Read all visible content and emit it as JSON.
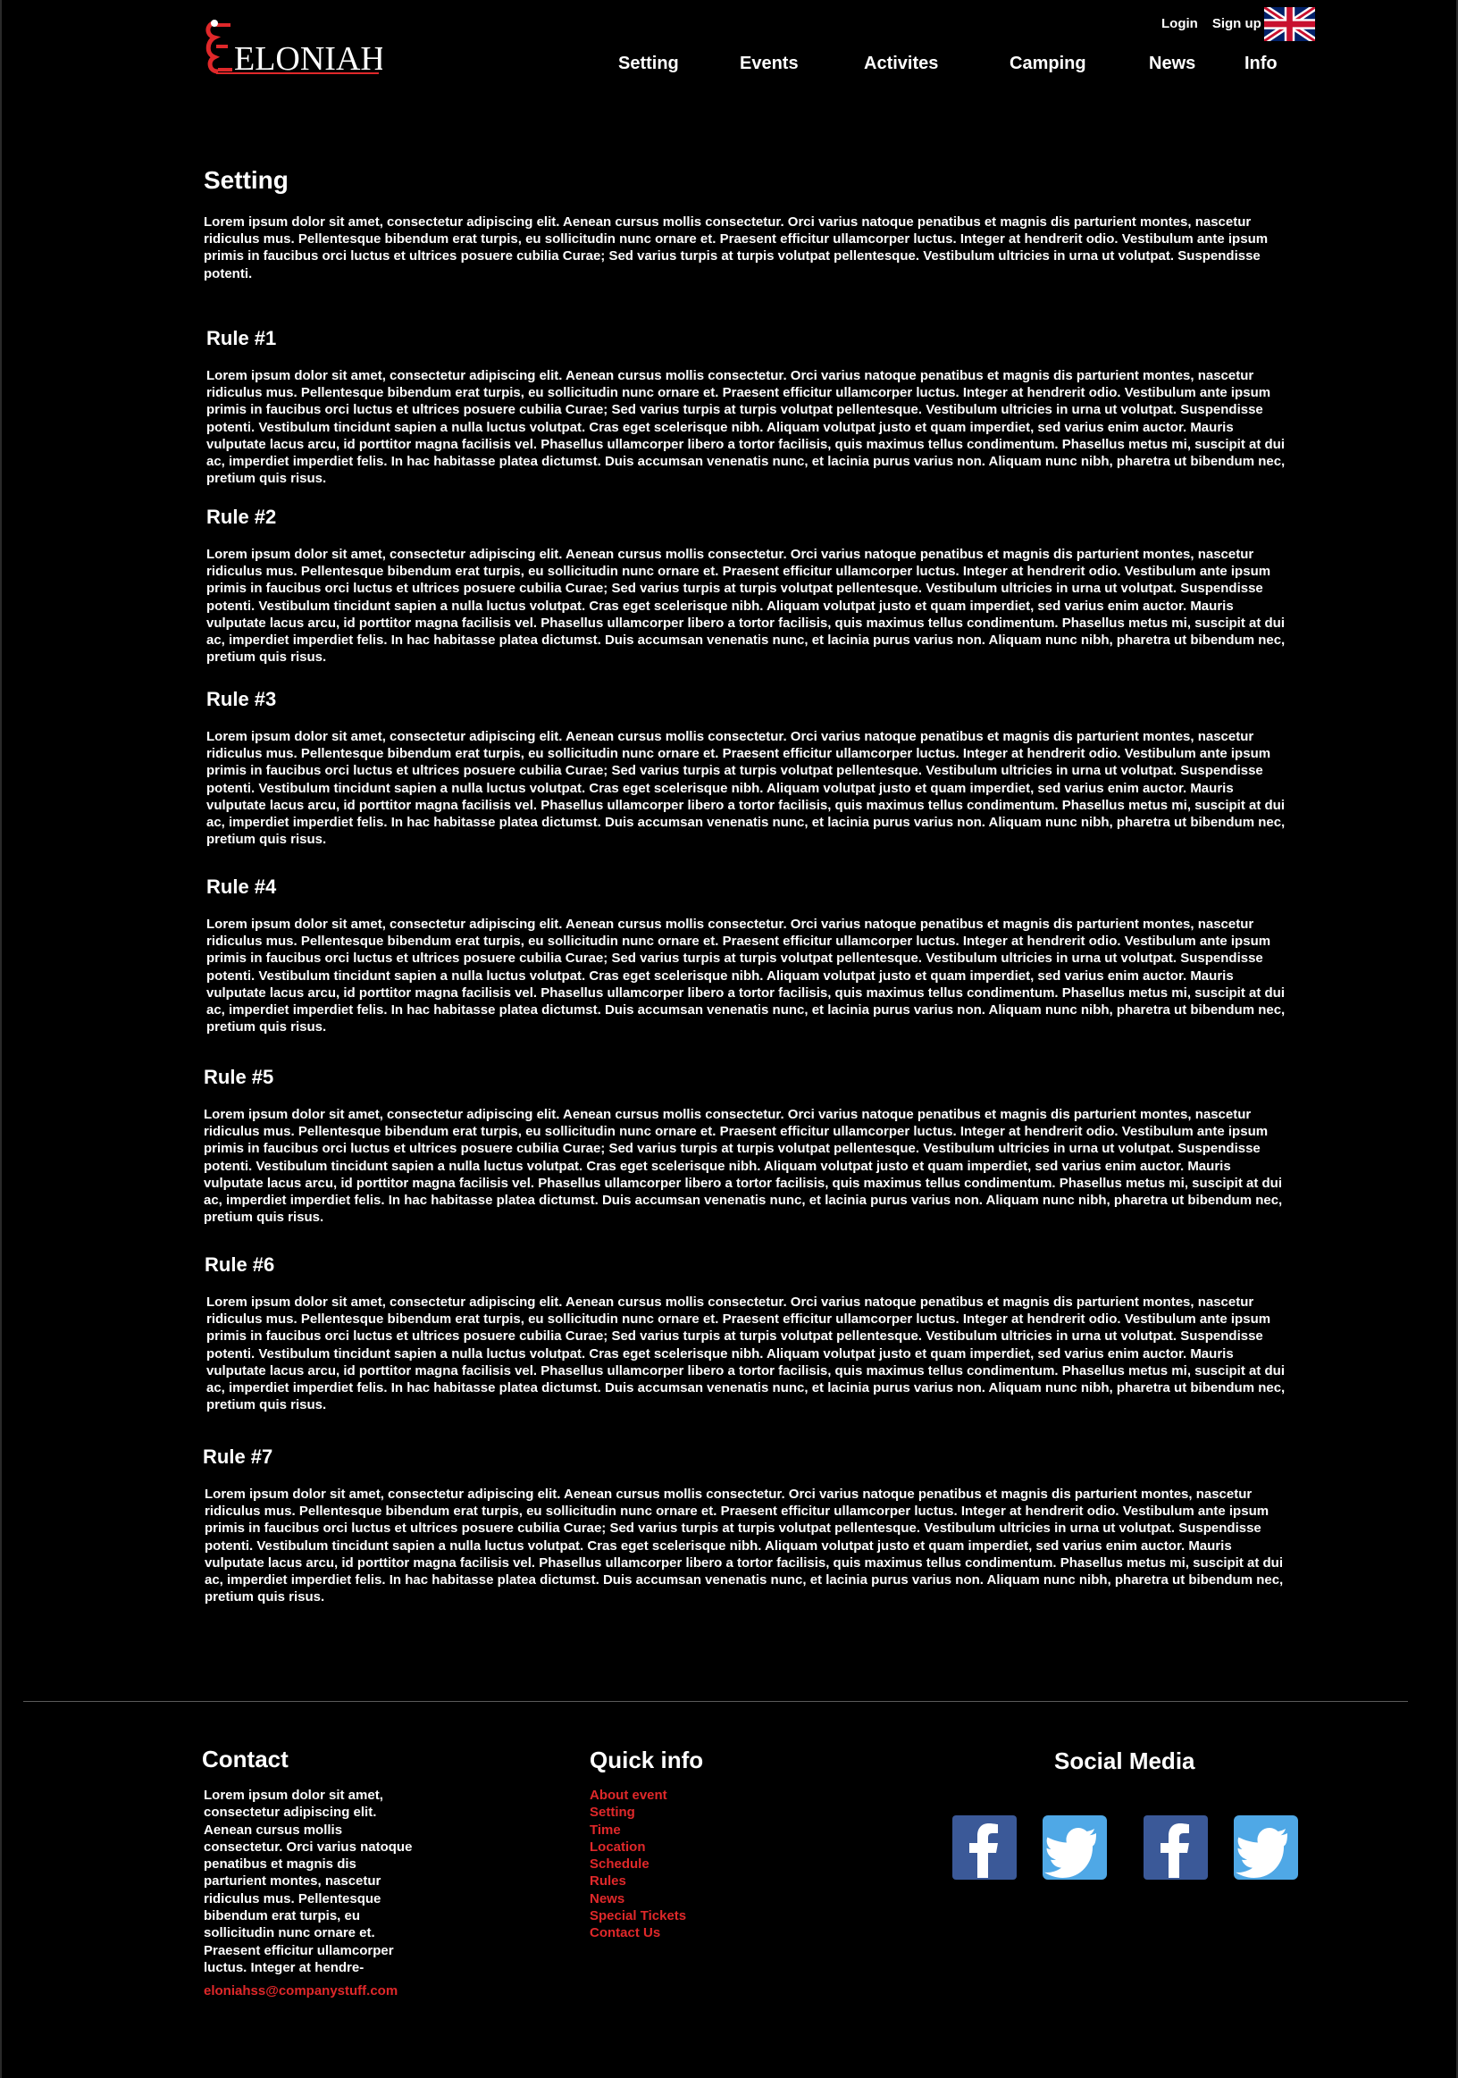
{
  "header": {
    "logo_text": "ELONIAH",
    "login_label": "Login",
    "signup_label": "Sign up",
    "language_icon": "uk-flag-icon"
  },
  "nav": {
    "items": [
      {
        "label": "Setting"
      },
      {
        "label": "Events"
      },
      {
        "label": "Activites"
      },
      {
        "label": "Camping"
      },
      {
        "label": "News"
      },
      {
        "label": "Info"
      }
    ]
  },
  "main": {
    "title": "Setting",
    "intro": "Lorem ipsum dolor sit amet, consectetur adipiscing elit. Aenean cursus mollis consectetur. Orci varius natoque penatibus et magnis dis parturient montes, nascetur ridiculus mus. Pellentesque bibendum erat turpis, eu sollicitudin nunc ornare et. Praesent efficitur ullamcorper luctus. Integer at hendrerit odio. Vestibulum ante ipsum primis in faucibus orci luctus et ultrices posuere cubilia Curae; Sed varius turpis at turpis volutpat pellentesque. Vestibulum ultricies in urna ut volutpat. Suspendisse potenti.",
    "rules": [
      {
        "title": "Rule #1",
        "text": "Lorem ipsum dolor sit amet, consectetur adipiscing elit. Aenean cursus mollis consectetur. Orci varius natoque penatibus et magnis dis parturient montes, nascetur ridiculus mus. Pellentesque bibendum erat turpis, eu sollicitudin nunc ornare et. Praesent efficitur ullamcorper luctus. Integer at hendrerit odio. Vestibulum ante ipsum primis in faucibus orci luctus et ultrices posuere cubilia Curae; Sed varius turpis at turpis volutpat pellentesque. Vestibulum ultricies in urna ut volutpat. Suspendisse potenti. Vestibulum tincidunt sapien a nulla luctus volutpat. Cras eget scelerisque nibh. Aliquam volutpat justo et quam imperdiet, sed varius enim auctor. Mauris vulputate lacus arcu, id porttitor magna facilisis vel. Phasellus ullamcorper libero a tortor facilisis, quis maximus tellus condimentum. Phasellus metus mi, suscipit at dui ac, imperdiet imperdiet felis. In hac habitasse platea dictumst. Duis accumsan venenatis nunc, et lacinia purus varius non. Aliquam nunc nibh, pharetra ut bibendum nec, pretium quis risus."
      },
      {
        "title": "Rule #2",
        "text": "Lorem ipsum dolor sit amet, consectetur adipiscing elit. Aenean cursus mollis consectetur. Orci varius natoque penatibus et magnis dis parturient montes, nascetur ridiculus mus. Pellentesque bibendum erat turpis, eu sollicitudin nunc ornare et. Praesent efficitur ullamcorper luctus. Integer at hendrerit odio. Vestibulum ante ipsum primis in faucibus orci luctus et ultrices posuere cubilia Curae; Sed varius turpis at turpis volutpat pellentesque. Vestibulum ultricies in urna ut volutpat. Suspendisse potenti. Vestibulum tincidunt sapien a nulla luctus volutpat. Cras eget scelerisque nibh. Aliquam volutpat justo et quam imperdiet, sed varius enim auctor. Mauris vulputate lacus arcu, id porttitor magna facilisis vel. Phasellus ullamcorper libero a tortor facilisis, quis maximus tellus condimentum. Phasellus metus mi, suscipit at dui ac, imperdiet imperdiet felis. In hac habitasse platea dictumst. Duis accumsan venenatis nunc, et lacinia purus varius non. Aliquam nunc nibh, pharetra ut bibendum nec, pretium quis risus."
      },
      {
        "title": "Rule #3",
        "text": "Lorem ipsum dolor sit amet, consectetur adipiscing elit. Aenean cursus mollis consectetur. Orci varius natoque penatibus et magnis dis parturient montes, nascetur ridiculus mus. Pellentesque bibendum erat turpis, eu sollicitudin nunc ornare et. Praesent efficitur ullamcorper luctus. Integer at hendrerit odio. Vestibulum ante ipsum primis in faucibus orci luctus et ultrices posuere cubilia Curae; Sed varius turpis at turpis volutpat pellentesque. Vestibulum ultricies in urna ut volutpat. Suspendisse potenti. Vestibulum tincidunt sapien a nulla luctus volutpat. Cras eget scelerisque nibh. Aliquam volutpat justo et quam imperdiet, sed varius enim auctor. Mauris vulputate lacus arcu, id porttitor magna facilisis vel. Phasellus ullamcorper libero a tortor facilisis, quis maximus tellus condimentum. Phasellus metus mi, suscipit at dui ac, imperdiet imperdiet felis. In hac habitasse platea dictumst. Duis accumsan venenatis nunc, et lacinia purus varius non. Aliquam nunc nibh, pharetra ut bibendum nec, pretium quis risus."
      },
      {
        "title": "Rule #4",
        "text": "Lorem ipsum dolor sit amet, consectetur adipiscing elit. Aenean cursus mollis consectetur. Orci varius natoque penatibus et magnis dis parturient montes, nascetur ridiculus mus. Pellentesque bibendum erat turpis, eu sollicitudin nunc ornare et. Praesent efficitur ullamcorper luctus. Integer at hendrerit odio. Vestibulum ante ipsum primis in faucibus orci luctus et ultrices posuere cubilia Curae; Sed varius turpis at turpis volutpat pellentesque. Vestibulum ultricies in urna ut volutpat. Suspendisse potenti. Vestibulum tincidunt sapien a nulla luctus volutpat. Cras eget scelerisque nibh. Aliquam volutpat justo et quam imperdiet, sed varius enim auctor. Mauris vulputate lacus arcu, id porttitor magna facilisis vel. Phasellus ullamcorper libero a tortor facilisis, quis maximus tellus condimentum. Phasellus metus mi, suscipit at dui ac, imperdiet imperdiet felis. In hac habitasse platea dictumst. Duis accumsan venenatis nunc, et lacinia purus varius non. Aliquam nunc nibh, pharetra ut bibendum nec, pretium quis risus."
      },
      {
        "title": "Rule #5",
        "text": "Lorem ipsum dolor sit amet, consectetur adipiscing elit. Aenean cursus mollis consectetur. Orci varius natoque penatibus et magnis dis parturient montes, nascetur ridiculus mus. Pellentesque bibendum erat turpis, eu sollicitudin nunc ornare et. Praesent efficitur ullamcorper luctus. Integer at hendrerit odio. Vestibulum ante ipsum primis in faucibus orci luctus et ultrices posuere cubilia Curae; Sed varius turpis at turpis volutpat pellentesque. Vestibulum ultricies in urna ut volutpat. Suspendisse potenti. Vestibulum tincidunt sapien a nulla luctus volutpat. Cras eget scelerisque nibh. Aliquam volutpat justo et quam imperdiet, sed varius enim auctor. Mauris vulputate lacus arcu, id porttitor magna facilisis vel. Phasellus ullamcorper libero a tortor facilisis, quis maximus tellus condimentum. Phasellus metus mi, suscipit at dui ac, imperdiet imperdiet felis. In hac habitasse platea dictumst. Duis accumsan venenatis nunc, et lacinia purus varius non. Aliquam nunc nibh, pharetra ut bibendum nec, pretium quis risus."
      },
      {
        "title": "Rule #6",
        "text": "Lorem ipsum dolor sit amet, consectetur adipiscing elit. Aenean cursus mollis consectetur. Orci varius natoque penatibus et magnis dis parturient montes, nascetur ridiculus mus. Pellentesque bibendum erat turpis, eu sollicitudin nunc ornare et. Praesent efficitur ullamcorper luctus. Integer at hendrerit odio. Vestibulum ante ipsum primis in faucibus orci luctus et ultrices posuere cubilia Curae; Sed varius turpis at turpis volutpat pellentesque. Vestibulum ultricies in urna ut volutpat. Suspendisse potenti. Vestibulum tincidunt sapien a nulla luctus volutpat. Cras eget scelerisque nibh. Aliquam volutpat justo et quam imperdiet, sed varius enim auctor. Mauris vulputate lacus arcu, id porttitor magna facilisis vel. Phasellus ullamcorper libero a tortor facilisis, quis maximus tellus condimentum. Phasellus metus mi, suscipit at dui ac, imperdiet imperdiet felis. In hac habitasse platea dictumst. Duis accumsan venenatis nunc, et lacinia purus varius non. Aliquam nunc nibh, pharetra ut bibendum nec, pretium quis risus."
      },
      {
        "title": "Rule #7",
        "text": "Lorem ipsum dolor sit amet, consectetur adipiscing elit. Aenean cursus mollis consectetur. Orci varius natoque penatibus et magnis dis parturient montes, nascetur ridiculus mus. Pellentesque bibendum erat turpis, eu sollicitudin nunc ornare et. Praesent efficitur ullamcorper luctus. Integer at hendrerit odio. Vestibulum ante ipsum primis in faucibus orci luctus et ultrices posuere cubilia Curae; Sed varius turpis at turpis volutpat pellentesque. Vestibulum ultricies in urna ut volutpat. Suspendisse potenti. Vestibulum tincidunt sapien a nulla luctus volutpat. Cras eget scelerisque nibh. Aliquam volutpat justo et quam imperdiet, sed varius enim auctor. Mauris vulputate lacus arcu, id porttitor magna facilisis vel. Phasellus ullamcorper libero a tortor facilisis, quis maximus tellus condimentum. Phasellus metus mi, suscipit at dui ac, imperdiet imperdiet felis. In hac habitasse platea dictumst. Duis accumsan venenatis nunc, et lacinia purus varius non. Aliquam nunc nibh, pharetra ut bibendum nec, pretium quis risus."
      }
    ]
  },
  "footer": {
    "contact": {
      "title": "Contact",
      "text": "Lorem ipsum dolor sit amet, consectetur adipiscing elit. Aenean cursus mollis consectetur. Orci varius natoque penatibus et magnis dis parturient montes, nascetur ridiculus mus. Pellentesque bibendum erat turpis, eu sollicitudin nunc ornare et. Praesent efficitur ullamcorper luctus. Integer at hendre-",
      "email": "eloniahss@companystuff.com"
    },
    "quick_info": {
      "title": "Quick info",
      "links": [
        {
          "label": "About event"
        },
        {
          "label": "Setting"
        },
        {
          "label": "Time"
        },
        {
          "label": "Location"
        },
        {
          "label": "Schedule"
        },
        {
          "label": "Rules"
        },
        {
          "label": "News"
        },
        {
          "label": "Special Tickets"
        },
        {
          "label": "Contact Us"
        }
      ]
    },
    "social": {
      "title": "Social Media",
      "icons": [
        "facebook-icon",
        "twitter-icon",
        "facebook-icon",
        "twitter-icon"
      ]
    }
  },
  "colors": {
    "background": "#000000",
    "text": "#ffffff",
    "accent_red": "#e0282a",
    "facebook_blue": "#3b5998",
    "twitter_blue": "#4fa8e6"
  }
}
